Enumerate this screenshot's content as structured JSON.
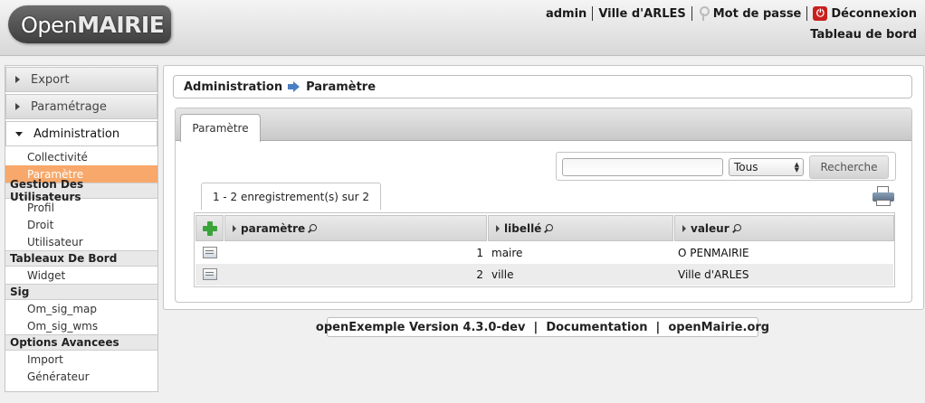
{
  "header": {
    "logo": {
      "part1": "Open",
      "part2": "MAIRIE"
    },
    "user": "admin",
    "collectivite": "Ville d'ARLES",
    "password_link": "Mot de passe",
    "logout_link": "Déconnexion",
    "dashboard_link": "Tableau de bord"
  },
  "sidebar": {
    "sections": [
      {
        "label": "Export"
      },
      {
        "label": "Paramétrage"
      },
      {
        "label": "Administration"
      }
    ],
    "admin_items": {
      "collectivite": "Collectivité",
      "parametre": "Paramètre",
      "group_users": "Gestion Des Utilisateurs",
      "profil": "Profil",
      "droit": "Droit",
      "utilisateur": "Utilisateur",
      "group_dashboards": "Tableaux De Bord",
      "widget": "Widget",
      "group_sig": "Sig",
      "om_sig_map": "Om_sig_map",
      "om_sig_wms": "Om_sig_wms",
      "group_advanced": "Options Avancees",
      "import": "Import",
      "generateur": "Générateur"
    }
  },
  "main": {
    "breadcrumb": {
      "root": "Administration",
      "current": "Paramètre"
    },
    "tab_label": "Paramètre",
    "search": {
      "value": "",
      "select_value": "Tous",
      "button_label": "Recherche"
    },
    "record_count": "1 - 2 enregistrement(s) sur 2",
    "table": {
      "columns": [
        "paramètre",
        "libellé",
        "valeur"
      ],
      "rows": [
        {
          "id": "1",
          "libelle": "maire",
          "valeur": "O PENMAIRIE"
        },
        {
          "id": "2",
          "libelle": "ville",
          "valeur": "Ville d'ARLES"
        }
      ]
    }
  },
  "footer": {
    "version": "openExemple Version 4.3.0-dev",
    "sep": "|",
    "documentation": "Documentation",
    "site": "openMairie.org"
  }
}
